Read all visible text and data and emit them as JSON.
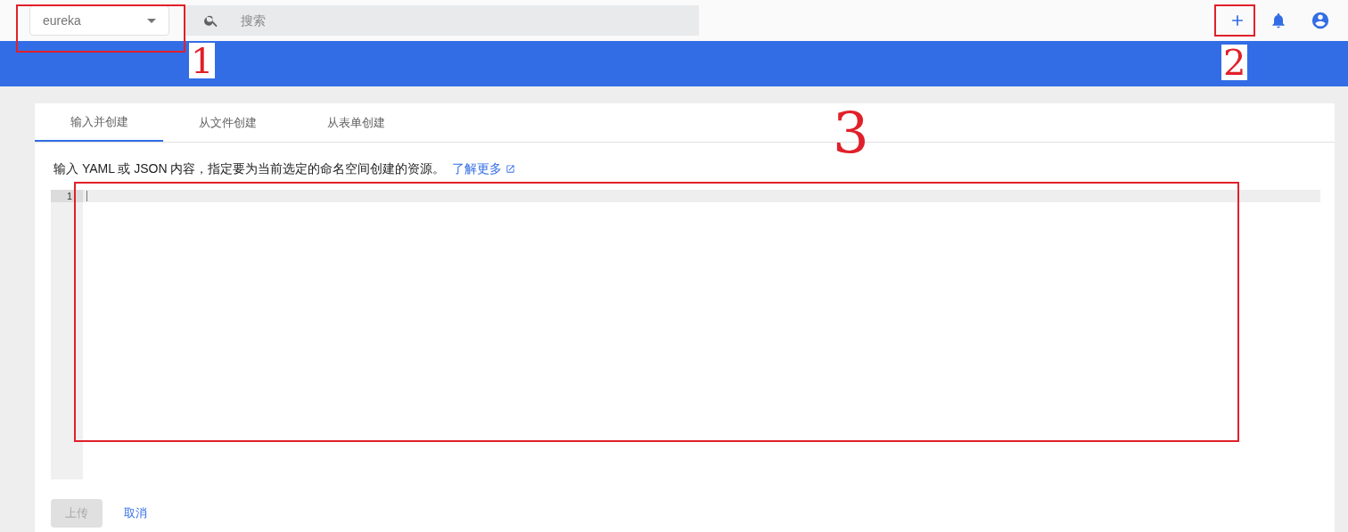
{
  "namespace_select": {
    "value": "eureka"
  },
  "search": {
    "placeholder": "搜索"
  },
  "tabs": [
    {
      "label": "输入并创建",
      "selected": true
    },
    {
      "label": "从文件创建",
      "selected": false
    },
    {
      "label": "从表单创建",
      "selected": false
    }
  ],
  "description": {
    "text": "输入 YAML 或 JSON 内容，指定要为当前选定的命名空间创建的资源。",
    "link": "了解更多"
  },
  "editor": {
    "line_numbers": [
      "1"
    ]
  },
  "buttons": [
    {
      "label": "上传",
      "kind": "primary",
      "disabled": true
    },
    {
      "label": "取消",
      "kind": "flat",
      "disabled": false
    }
  ],
  "annotations": [
    {
      "label": "1"
    },
    {
      "label": "2"
    },
    {
      "label": "3"
    }
  ]
}
